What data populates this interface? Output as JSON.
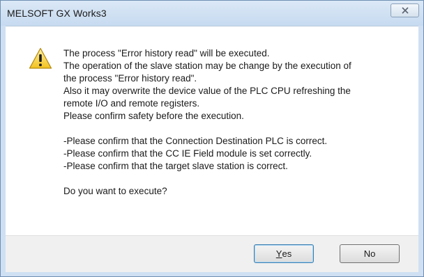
{
  "window": {
    "title": "MELSOFT GX Works3"
  },
  "icons": {
    "close": "close-icon",
    "warning": "warning-icon"
  },
  "message": {
    "paragraph1": [
      "The process \"Error history read\" will be executed.",
      "The operation of the slave station may be change by the execution of",
      "the process \"Error history read\".",
      "Also it may overwrite the device value of the PLC CPU refreshing the",
      "remote I/O and remote registers.",
      "Please confirm safety before the execution."
    ],
    "paragraph2": [
      "-Please confirm that the Connection Destination PLC is correct.",
      "-Please confirm that the CC IE Field module is set correctly.",
      "-Please confirm that the target slave station is correct."
    ],
    "question": "Do you want to execute?"
  },
  "buttons": {
    "yes_mnemonic": "Y",
    "yes_rest": "es",
    "no_label": "No"
  }
}
